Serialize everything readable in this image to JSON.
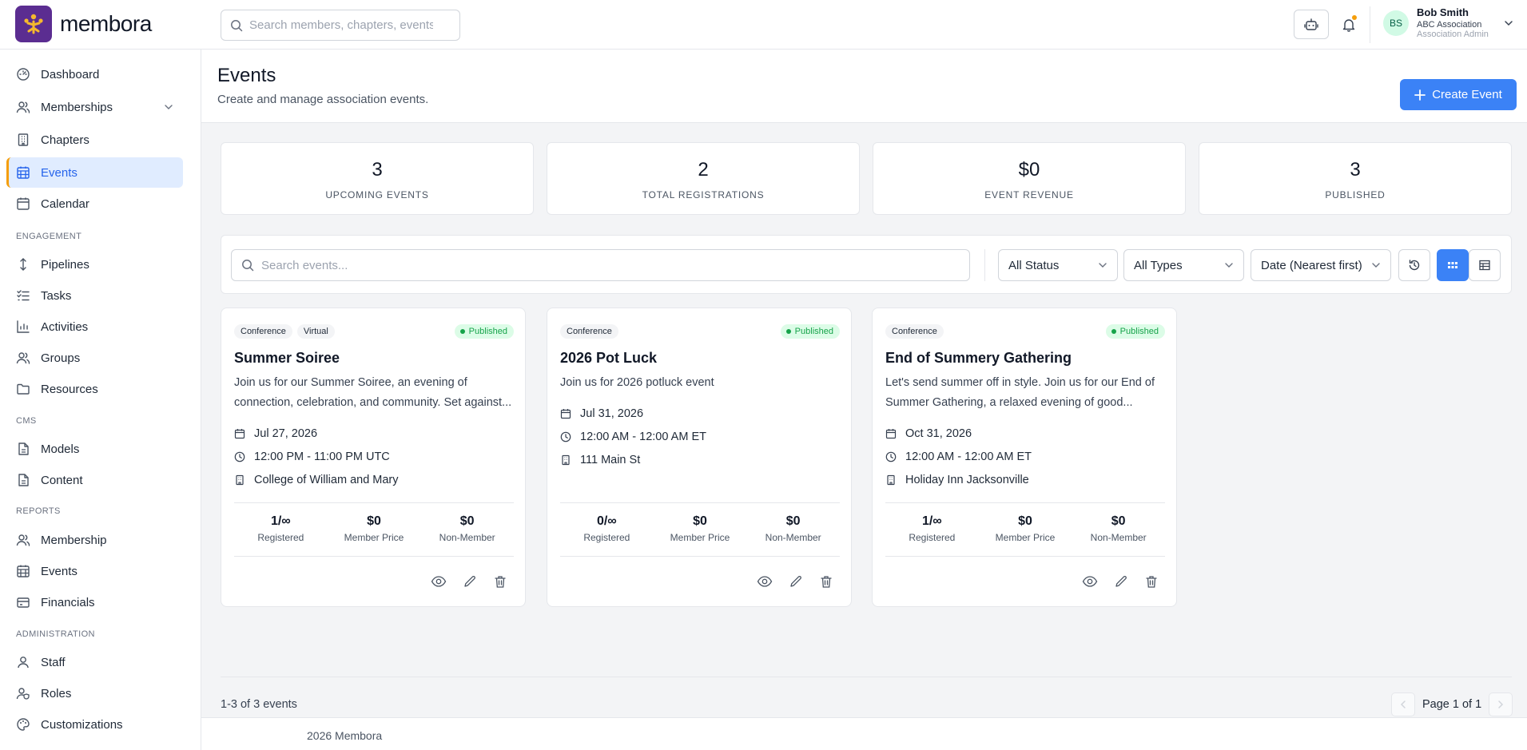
{
  "app": {
    "name": "membora"
  },
  "topbar": {
    "search_placeholder": "Search members, chapters, events...",
    "user": {
      "initials": "BS",
      "name": "Bob Smith",
      "org": "ABC Association",
      "role": "Association Admin"
    }
  },
  "sidebar": {
    "main": [
      {
        "label": "Dashboard",
        "icon": "dashboard-icon"
      },
      {
        "label": "Memberships",
        "icon": "users-icon"
      },
      {
        "label": "Chapters",
        "icon": "building-icon"
      },
      {
        "label": "Events",
        "icon": "calendar-grid-icon",
        "active": true
      },
      {
        "label": "Calendar",
        "icon": "calendar-icon"
      }
    ],
    "sections": [
      {
        "label": "ENGAGEMENT",
        "items": [
          "Pipelines",
          "Tasks",
          "Activities",
          "Groups",
          "Resources"
        ]
      },
      {
        "label": "CMS",
        "items": [
          "Models",
          "Content"
        ]
      },
      {
        "label": "REPORTS",
        "items": [
          "Membership",
          "Events",
          "Financials"
        ]
      },
      {
        "label": "ADMINISTRATION",
        "items": [
          "Staff",
          "Roles",
          "Customizations"
        ]
      }
    ]
  },
  "header": {
    "title": "Events",
    "subtitle": "Create and manage association events.",
    "create_label": "Create Event"
  },
  "stats": [
    {
      "value": "3",
      "label": "UPCOMING EVENTS"
    },
    {
      "value": "2",
      "label": "TOTAL REGISTRATIONS"
    },
    {
      "value": "$0",
      "label": "EVENT REVENUE"
    },
    {
      "value": "3",
      "label": "PUBLISHED"
    }
  ],
  "filters": {
    "search_placeholder": "Search events...",
    "status": "All Status",
    "type": "All Types",
    "sort": "Date (Nearest first)"
  },
  "events": [
    {
      "tags": [
        "Conference",
        "Virtual"
      ],
      "status": "Published",
      "title": "Summer Soiree",
      "description": "Join us for our Summer Soiree, an evening of connection, celebration, and community. Set against...",
      "date": "Jul 27, 2026",
      "time": "12:00 PM - 11:00 PM UTC",
      "location": "College of William and Mary",
      "registered": "1/∞",
      "member_price": "$0",
      "non_member_price": "$0"
    },
    {
      "tags": [
        "Conference"
      ],
      "status": "Published",
      "title": "2026 Pot Luck",
      "description": "Join us for 2026 potluck event",
      "date": "Jul 31, 2026",
      "time": "12:00 AM - 12:00 AM ET",
      "location": "111 Main St",
      "registered": "0/∞",
      "member_price": "$0",
      "non_member_price": "$0"
    },
    {
      "tags": [
        "Conference"
      ],
      "status": "Published",
      "title": "End of Summery Gathering",
      "description": "Let's send summer off in style. Join us for our End of Summer Gathering, a relaxed evening of good...",
      "date": "Oct 31, 2026",
      "time": "12:00 AM - 12:00 AM ET",
      "location": "Holiday Inn Jacksonville",
      "registered": "1/∞",
      "member_price": "$0",
      "non_member_price": "$0"
    }
  ],
  "card_labels": {
    "registered": "Registered",
    "member_price": "Member Price",
    "non_member": "Non-Member"
  },
  "pagination": {
    "summary": "1-3 of 3 events",
    "page": "Page 1 of 1"
  },
  "footer": {
    "text": "2026 Membora"
  },
  "colors": {
    "brand": "#5b2d91",
    "accent": "#3b82f6",
    "published": "#16a34a",
    "active_marker": "#f59e0b"
  }
}
